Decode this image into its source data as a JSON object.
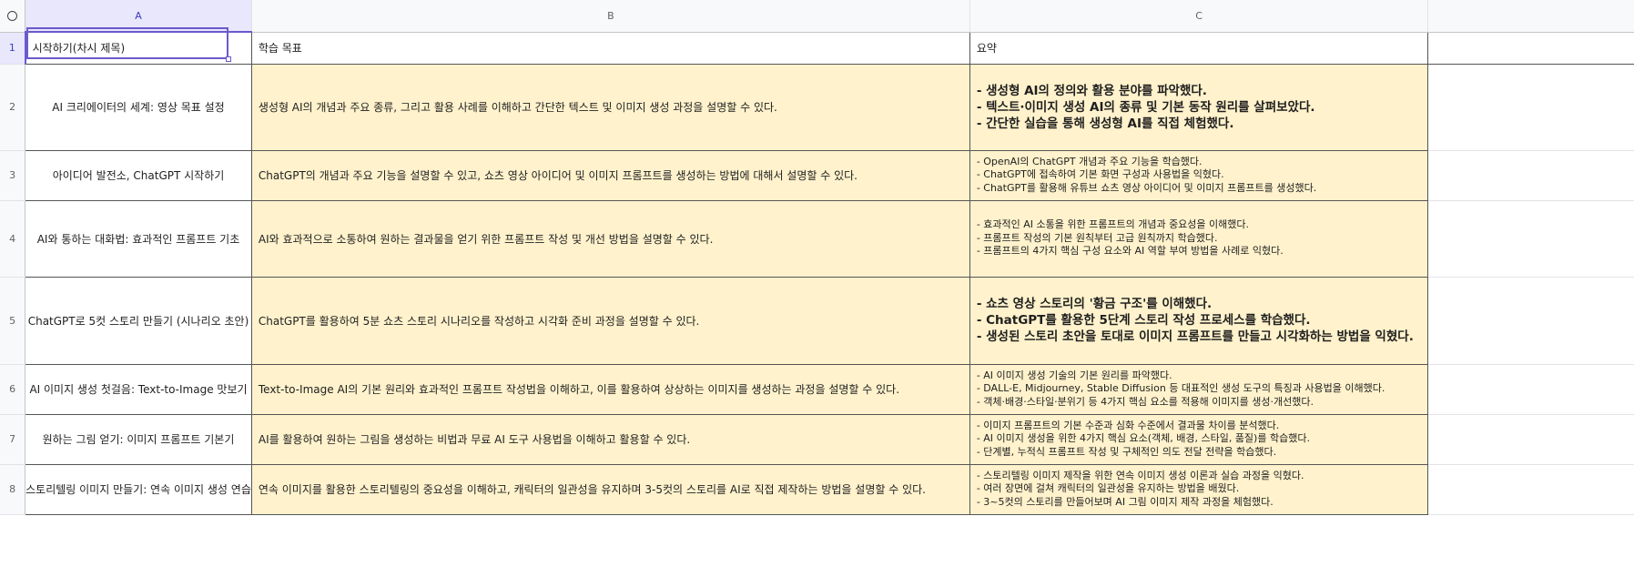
{
  "columns": [
    "A",
    "B",
    "C"
  ],
  "rows": [
    {
      "num": "1",
      "a": "시작하기(차시 제목)",
      "b": "학습 목표",
      "c": [
        "요약"
      ],
      "c_bold": false
    },
    {
      "num": "2",
      "a": "AI 크리에이터의 세계: 영상 목표 설정",
      "b": "생성형 AI의 개념과 주요 종류, 그리고 활용 사례를 이해하고 간단한 텍스트 및 이미지 생성 과정을 설명할 수 있다.",
      "c": [
        "- 생성형 AI의 정의와 활용 분야를 파악했다.",
        "- 텍스트·이미지 생성 AI의 종류 및 기본 동작 원리를 살펴보았다.",
        "- 간단한 실습을 통해 생성형 AI를 직접 체험했다."
      ],
      "c_bold": true
    },
    {
      "num": "3",
      "a": "아이디어 발전소, ChatGPT 시작하기",
      "b": "ChatGPT의 개념과 주요 기능을 설명할 수 있고, 쇼츠 영상 아이디어 및 이미지 프롬프트를 생성하는 방법에 대해서 설명할 수 있다.",
      "c": [
        "- OpenAI의 ChatGPT 개념과 주요 기능을 학습했다.",
        "- ChatGPT에 접속하여 기본 화면 구성과 사용법을 익혔다.",
        "- ChatGPT를 활용해 유튜브 쇼츠 영상 아이디어 및 이미지 프롬프트를 생성했다."
      ],
      "c_bold": false
    },
    {
      "num": "4",
      "a": "AI와 통하는 대화법: 효과적인 프롬프트 기초",
      "b": "AI와 효과적으로 소통하여 원하는 결과물을 얻기 위한 프롬프트 작성 및 개선 방법을 설명할 수 있다.",
      "c": [
        "- 효과적인 AI 소통을 위한 프롬프트의 개념과 중요성을 이해했다.",
        "- 프롬프트 작성의 기본 원칙부터 고급 원칙까지 학습했다.",
        "- 프롬프트의 4가지 핵심 구성 요소와 AI 역할 부여 방법을 사례로 익혔다."
      ],
      "c_bold": false
    },
    {
      "num": "5",
      "a": "ChatGPT로 5컷 스토리 만들기 (시나리오 초안)",
      "b": "ChatGPT를 활용하여 5분 쇼츠 스토리 시나리오를 작성하고 시각화 준비 과정을 설명할 수 있다.",
      "c": [
        "- 쇼츠 영상 스토리의 '황금 구조'를 이해했다.",
        "- ChatGPT를 활용한 5단계 스토리 작성 프로세스를 학습했다.",
        "- 생성된 스토리 초안을 토대로 이미지 프롬프트를 만들고 시각화하는 방법을 익혔다."
      ],
      "c_bold": true
    },
    {
      "num": "6",
      "a": "AI 이미지 생성 첫걸음: Text-to-Image 맛보기",
      "b": "Text-to-Image AI의 기본 원리와 효과적인 프롬프트 작성법을 이해하고, 이를 활용하여 상상하는 이미지를 생성하는 과정을 설명할 수 있다.",
      "c": [
        "- AI 이미지 생성 기술의 기본 원리를 파악했다.",
        "- DALL-E, Midjourney, Stable Diffusion 등 대표적인 생성 도구의 특징과 사용법을 이해했다.",
        "- 객체·배경·스타일·분위기 등 4가지 핵심 요소를 적용해 이미지를 생성·개선했다."
      ],
      "c_bold": false
    },
    {
      "num": "7",
      "a": "원하는 그림 얻기: 이미지 프롬프트 기본기",
      "b": "AI를 활용하여 원하는 그림을 생성하는 비법과 무료 AI 도구 사용법을 이해하고 활용할 수 있다.",
      "c": [
        "- 이미지 프롬프트의 기본 수준과 심화 수준에서 결과물 차이를 분석했다.",
        "- AI 이미지 생성을 위한 4가지 핵심 요소(객체, 배경, 스타일, 품질)를 학습했다.",
        "- 단계별, 누적식 프롬프트 작성 및 구체적인 의도 전달 전략을 학습했다."
      ],
      "c_bold": false
    },
    {
      "num": "8",
      "a": "스토리텔링 이미지 만들기: 연속 이미지 생성 연습",
      "b": "연속 이미지를 활용한 스토리텔링의 중요성을 이해하고, 캐릭터의 일관성을 유지하며 3-5컷의 스토리를 AI로 직접 제작하는 방법을 설명할 수 있다.",
      "c": [
        "- 스토리텔링 이미지 제작을 위한 연속 이미지 생성 이론과 실습 과정을 익혔다.",
        "- 여러 장면에 걸쳐 캐릭터의 일관성을 유지하는 방법을 배웠다.",
        "- 3~5컷의 스토리를 만들어보며 AI 그림 이미지 제작 과정을 체험했다."
      ],
      "c_bold": false
    }
  ]
}
